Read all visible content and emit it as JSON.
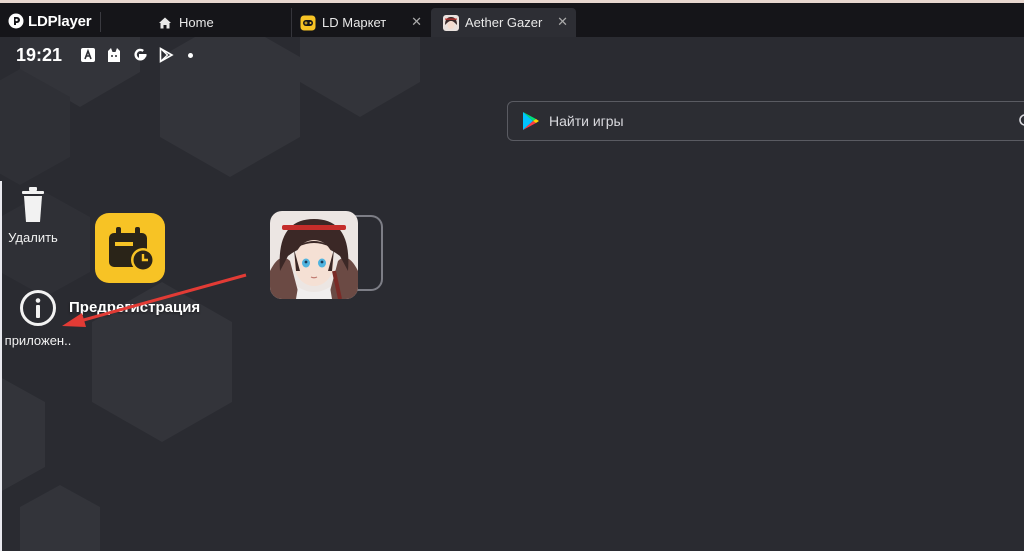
{
  "window": {
    "app_name": "LDPlayer",
    "tabs": [
      {
        "label": "Home",
        "icon": "home-icon",
        "closable": false
      },
      {
        "label": "LD Маркет",
        "icon": "gamepad-icon",
        "closable": true
      },
      {
        "label": "Aether Gazer",
        "icon": "game-avatar-icon",
        "closable": true,
        "active": true
      }
    ],
    "close_glyph": "✕"
  },
  "statusbar": {
    "time": "19:21",
    "icons": [
      "notification-a-icon",
      "cat-app-icon",
      "google-g-icon",
      "play-store-icon",
      "more-dot-icon"
    ]
  },
  "search": {
    "placeholder": "Найти игры"
  },
  "drag_actions": {
    "uninstall_label": "Удалить",
    "info_label": "приложен.."
  },
  "apps": {
    "prereg_label": "Предрегистрация",
    "prereg_color": "#f7c325",
    "dragged_app": "Aether Gazer"
  },
  "colors": {
    "titlebar": "#151519",
    "desktop": "#2a2b31",
    "arrow": "#e23b35"
  }
}
